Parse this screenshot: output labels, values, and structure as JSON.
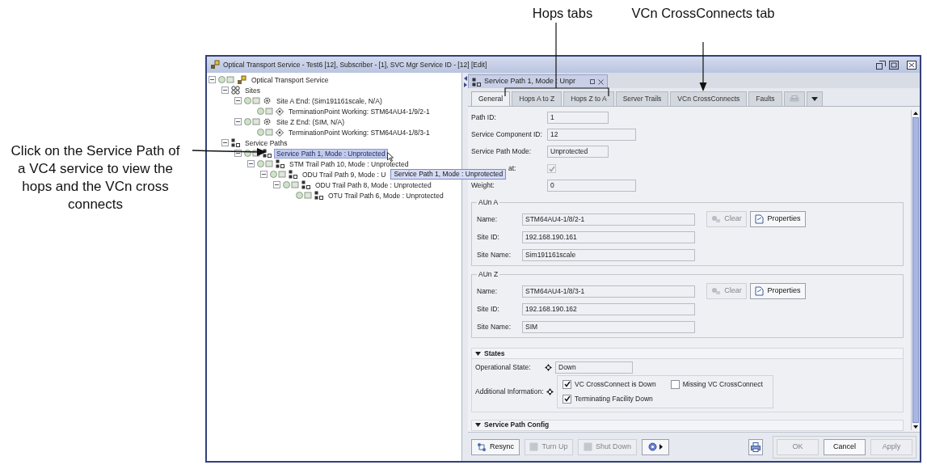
{
  "callouts": {
    "service_path": "Click on the Service Path of a VC4 service to view the hops and the VCn cross connects",
    "hops_tabs": "Hops tabs",
    "crossconnects_tab": "VCn CrossConnects tab"
  },
  "window": {
    "title": "Optical Transport Service - Test6 [12], Subscriber - [1], SVC Mgr Service ID - [12] [Edit]"
  },
  "tree": [
    {
      "kind": "service",
      "label": "Optical Transport Service",
      "selected": false,
      "expanded": true,
      "children": [
        {
          "kind": "sites",
          "label": "Sites",
          "selected": false,
          "expanded": true,
          "children": [
            {
              "kind": "site",
              "label": "Site A End: (Sim191161scale, N/A)",
              "selected": false,
              "expanded": true,
              "children": [
                {
                  "kind": "termination",
                  "label": "TerminationPoint Working: STM64AU4-1/9/2-1",
                  "selected": false
                }
              ]
            },
            {
              "kind": "site",
              "label": "Site Z End: (SIM, N/A)",
              "selected": false,
              "expanded": true,
              "children": [
                {
                  "kind": "termination",
                  "label": "TerminationPoint Working: STM64AU4-1/8/3-1",
                  "selected": false
                }
              ]
            }
          ]
        },
        {
          "kind": "paths",
          "label": "Service Paths",
          "selected": false,
          "expanded": true,
          "children": [
            {
              "kind": "path",
              "label": "Service Path 1, Mode : Unprotected",
              "selected": true,
              "expanded": true,
              "children": [
                {
                  "kind": "path",
                  "label": "STM Trail Path 10, Mode : Unprotected",
                  "selected": false,
                  "expanded": true,
                  "children": [
                    {
                      "kind": "path",
                      "label": "ODU Trail Path 9, Mode : U",
                      "tooltip": "Service Path 1, Mode : Unprotected",
                      "selected": false,
                      "expanded": true,
                      "children": [
                        {
                          "kind": "path",
                          "label": "ODU Trail Path 8, Mode : Unprotected",
                          "selected": false,
                          "expanded": true,
                          "children": [
                            {
                              "kind": "path",
                              "label": "OTU Trail Path 6, Mode : Unprotected",
                              "selected": false
                            }
                          ]
                        }
                      ]
                    }
                  ]
                }
              ]
            }
          ]
        }
      ]
    }
  ],
  "document_tab": {
    "label": "Service Path 1, Mode : Unpr"
  },
  "tabs": [
    {
      "label": "General",
      "selected": true
    },
    {
      "label": "Hops A to Z",
      "selected": false
    },
    {
      "label": "Hops Z to A",
      "selected": false
    },
    {
      "label": "Server Trails",
      "selected": false
    },
    {
      "label": "VCn CrossConnects",
      "selected": false
    },
    {
      "label": "Faults",
      "selected": false
    }
  ],
  "general": [
    {
      "kind": "field",
      "label": "Path ID:",
      "value": "1"
    },
    {
      "kind": "field",
      "label": "Service Component ID:",
      "value": "12"
    },
    {
      "kind": "field",
      "label": "Service Path Mode:",
      "value": "Unprotected"
    },
    {
      "kind": "checkbox",
      "label": "at:",
      "checked": true,
      "disabled": true
    },
    {
      "kind": "field",
      "label": "Weight:",
      "value": "0"
    }
  ],
  "endpoints": [
    {
      "legend": "AUn A",
      "rows": [
        {
          "label": "Name:",
          "value": "STM64AU4-1/8/2-1"
        },
        {
          "label": "Site ID:",
          "value": "192.168.190.161"
        },
        {
          "label": "Site Name:",
          "value": "Sim191161scale"
        }
      ],
      "buttons": [
        {
          "kind": "clear",
          "label": "Clear",
          "disabled": true
        },
        {
          "kind": "properties",
          "label": "Properties",
          "disabled": false
        }
      ]
    },
    {
      "legend": "AUn Z",
      "rows": [
        {
          "label": "Name:",
          "value": "STM64AU4-1/8/3-1"
        },
        {
          "label": "Site ID:",
          "value": "192.168.190.162"
        },
        {
          "label": "Site Name:",
          "value": "SIM"
        }
      ],
      "buttons": [
        {
          "kind": "clear",
          "label": "Clear",
          "disabled": true
        },
        {
          "kind": "properties",
          "label": "Properties",
          "disabled": false
        }
      ]
    }
  ],
  "states": {
    "title": "States",
    "operational_state": {
      "label": "Operational State:",
      "value": "Down"
    },
    "additional_information": {
      "label": "Additional Information:",
      "checks": [
        {
          "label": "VC CrossConnect is Down",
          "checked": true
        },
        {
          "label": "Missing VC CrossConnect",
          "checked": false
        },
        {
          "label": "Terminating Facility Down",
          "checked": true
        }
      ]
    }
  },
  "service_path_config": {
    "title": "Service Path Config"
  },
  "actions": [
    {
      "kind": "resync",
      "label": "Resync",
      "disabled": false
    },
    {
      "kind": "turn-up",
      "label": "Turn Up",
      "disabled": true
    },
    {
      "kind": "shut-down",
      "label": "Shut Down",
      "disabled": true
    }
  ],
  "dialog_buttons": [
    {
      "label": "OK",
      "disabled": true
    },
    {
      "label": "Cancel",
      "disabled": false
    },
    {
      "label": "Apply",
      "disabled": true
    }
  ]
}
